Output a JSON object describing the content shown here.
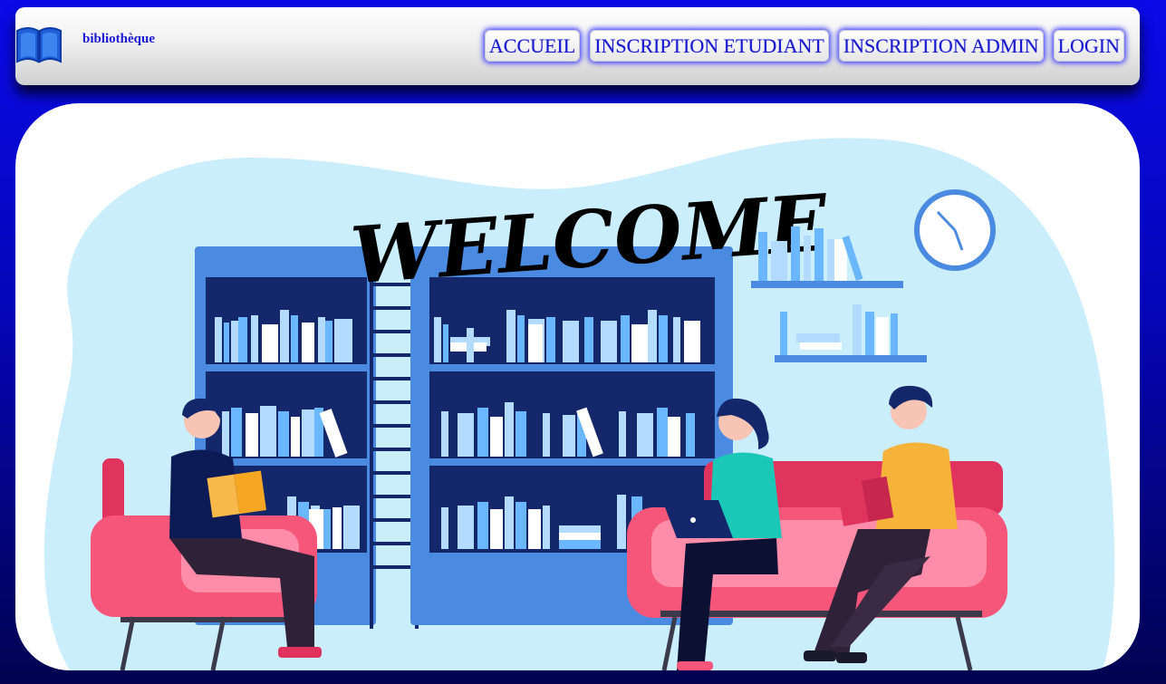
{
  "header": {
    "brand": "bibliothèque",
    "logo_icon": "open-book-icon",
    "nav": [
      {
        "label": "ACCUEIL"
      },
      {
        "label": "INSCRIPTION ETUDIANT"
      },
      {
        "label": "INSCRIPTION ADMIN"
      },
      {
        "label": "LOGIN"
      }
    ]
  },
  "hero": {
    "welcome_text": "WELCOME",
    "illustration": "library-reading-illustration"
  },
  "colors": {
    "background": "#0505b8",
    "nav_text": "#1818d0",
    "shelf_blue": "#4a8ae0",
    "blob": "#cbeefc",
    "sofa": "#f5567a"
  }
}
